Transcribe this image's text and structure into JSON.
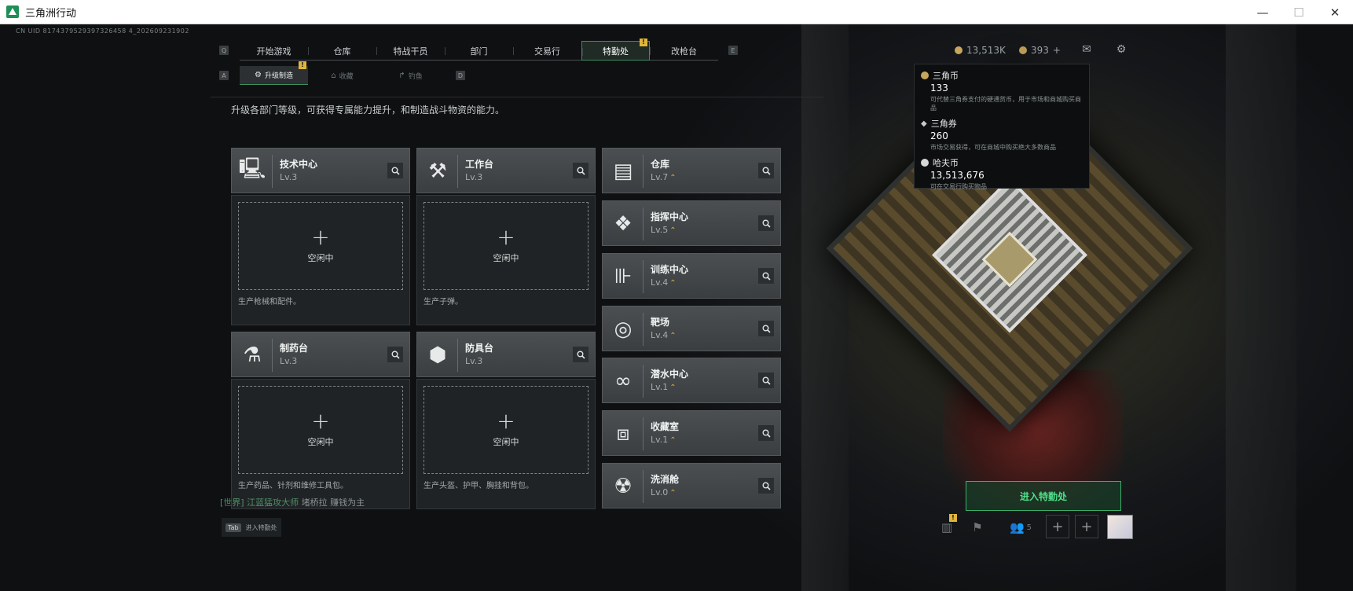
{
  "window": {
    "title": "三角洲行动",
    "minimize": "—",
    "maximize": "☐",
    "close": "✕"
  },
  "uid": "CN UID 8174379529397326458 4_202609231902",
  "main_tabs": [
    {
      "label": "开始游戏"
    },
    {
      "label": "仓库"
    },
    {
      "label": "特战干员"
    },
    {
      "label": "部门"
    },
    {
      "label": "交易行"
    },
    {
      "label": "特勤处",
      "active": true,
      "badge": "!"
    },
    {
      "label": "改枪台"
    }
  ],
  "key_hints": {
    "left": "Q",
    "right": "E",
    "sub_left": "A",
    "sub_right": "D"
  },
  "sub_tabs": [
    {
      "label": "升级制造",
      "icon": "⚙",
      "active": true,
      "badge": "!"
    },
    {
      "label": "收藏",
      "icon": "⌂"
    },
    {
      "label": "钓鱼",
      "icon": "↱"
    }
  ],
  "description": "升级各部门等级，可获得专属能力提升，和制造战斗物资的能力。",
  "production": [
    {
      "name": "技术中心",
      "level": "Lv.3",
      "icon": "computer-icon",
      "glyph": "🖳",
      "slot": "空闲中",
      "note": "生产枪械和配件。"
    },
    {
      "name": "工作台",
      "level": "Lv.3",
      "icon": "tools-icon",
      "glyph": "⚒",
      "slot": "空闲中",
      "note": "生产子弹。"
    },
    {
      "name": "制药台",
      "level": "Lv.3",
      "icon": "microscope-icon",
      "glyph": "⚗",
      "slot": "空闲中",
      "note": "生产药品、针剂和维修工具包。"
    },
    {
      "name": "防具台",
      "level": "Lv.3",
      "icon": "armor-cubes-icon",
      "glyph": "⬢",
      "slot": "空闲中",
      "note": "生产头盔、护甲、胸挂和背包。"
    }
  ],
  "facilities": [
    {
      "name": "仓库",
      "level": "Lv.7",
      "icon": "warehouse-icon",
      "glyph": "▤"
    },
    {
      "name": "指挥中心",
      "level": "Lv.5",
      "icon": "command-center-icon",
      "glyph": "❖"
    },
    {
      "name": "训练中心",
      "level": "Lv.4",
      "icon": "dumbbell-icon",
      "glyph": "⊪"
    },
    {
      "name": "靶场",
      "level": "Lv.4",
      "icon": "target-icon",
      "glyph": "◎"
    },
    {
      "name": "潜水中心",
      "level": "Lv.1",
      "icon": "diving-mask-icon",
      "glyph": "∞"
    },
    {
      "name": "收藏室",
      "level": "Lv.1",
      "icon": "collection-room-icon",
      "glyph": "⧈"
    },
    {
      "name": "洗消舱",
      "level": "Lv.0",
      "icon": "decontamination-icon",
      "glyph": "☢"
    }
  ],
  "up_arrow": "⌃",
  "currency": {
    "hafu": "13,513K",
    "ticket": "393",
    "plus": "+"
  },
  "tooltip": [
    {
      "name": "三角币",
      "value": "133",
      "desc": "可代替三角券支付的硬通货币，用于市场和商城购买商品"
    },
    {
      "name": "三角券",
      "value": "260",
      "desc": "市场交易获得，可在商城中购买绝大多数商品"
    },
    {
      "name": "哈夫币",
      "value": "13,513,676",
      "desc": "可在交易行购买物品"
    }
  ],
  "enter_button": "进入特勤处",
  "chat": {
    "channel": "[世界]",
    "user": "江蓝猛攻大师",
    "message": "堵桥拉    赚钱为主"
  },
  "tab_hint": {
    "key": "Tab",
    "label": "进入特勤处"
  },
  "bottom": {
    "friends_count": "5",
    "badge": "!"
  },
  "colors": {
    "accent": "#3bb06b",
    "badge": "#e2b53a",
    "level_up": "#d8b24a"
  }
}
